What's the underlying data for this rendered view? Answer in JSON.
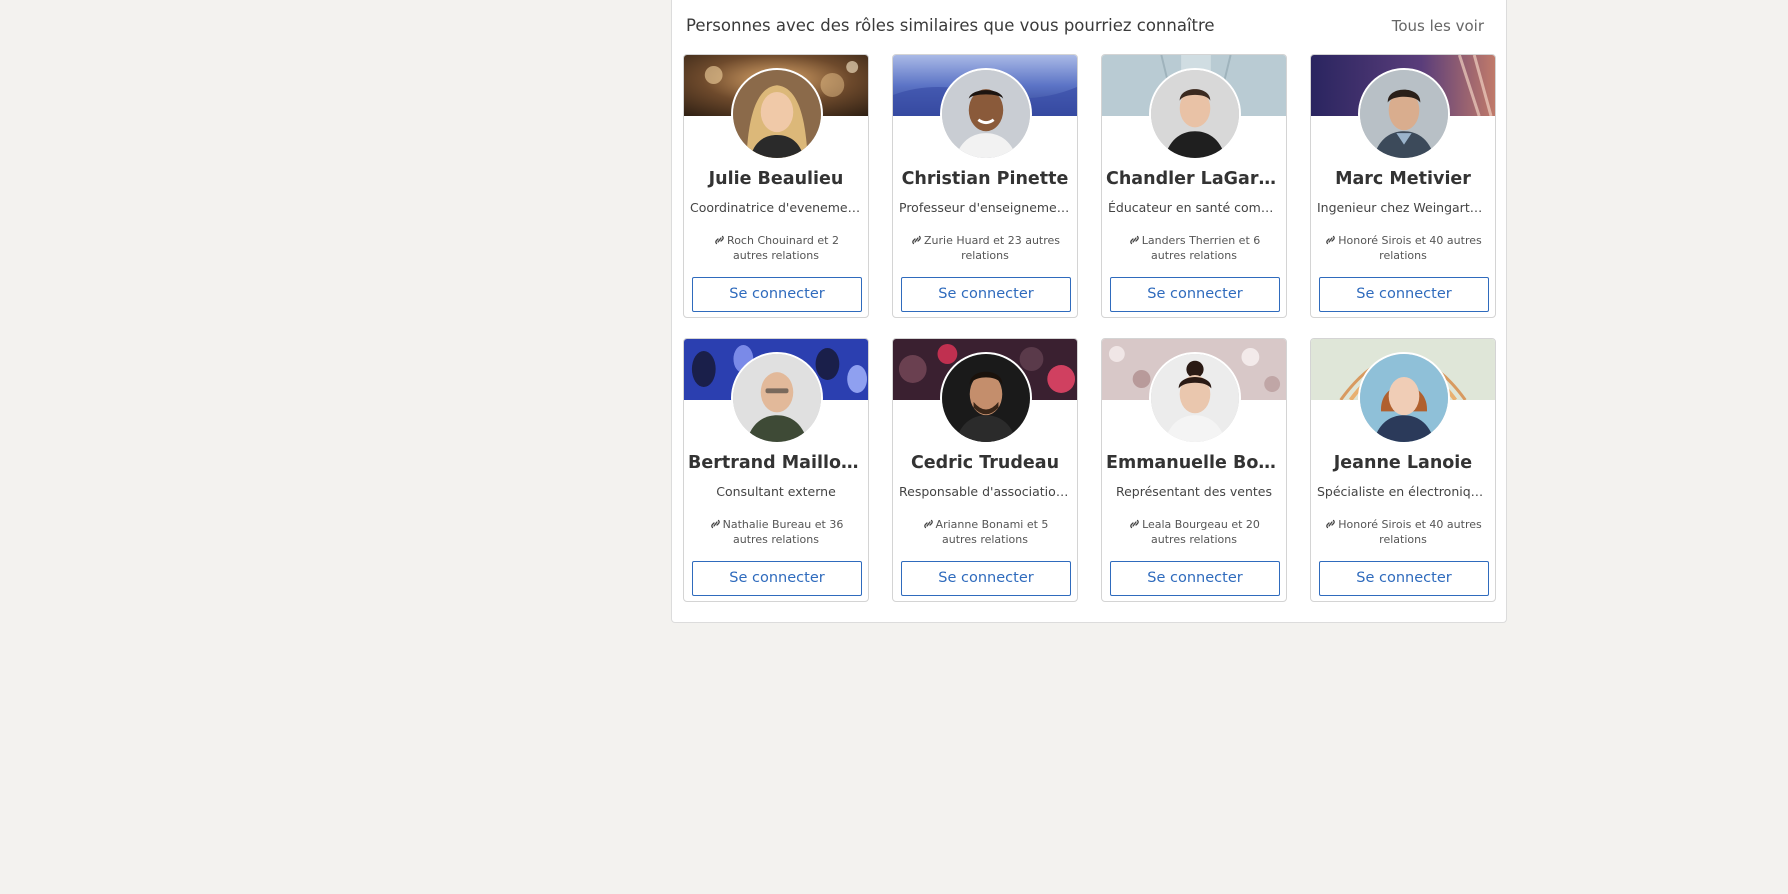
{
  "header": {
    "title": "Personnes avec des rôles similaires que vous pourriez connaître",
    "see_all": "Tous les voir"
  },
  "people": [
    {
      "name": "Julie Beaulieu",
      "role": "Coordinatrice d'evenement...",
      "mutual": "Roch Chouinard et 2 autres relations",
      "button": "Se connecter"
    },
    {
      "name": "Christian Pinette",
      "role": "Professeur d'enseignement...",
      "mutual": "Zurie Huard et 23 autres relations",
      "button": "Se connecter"
    },
    {
      "name": "Chandler LaGarde",
      "role": "Éducateur en santé commu...",
      "mutual": "Landers Therrien et 6 autres relations",
      "button": "Se connecter"
    },
    {
      "name": "Marc Metivier",
      "role": "Ingenieur chez Weingarten's",
      "mutual": "Honoré Sirois et 40 autres relations",
      "button": "Se connecter"
    },
    {
      "name": "Bertrand Mailloux",
      "role": "Consultant externe",
      "mutual": "Nathalie Bureau et 36 autres relations",
      "button": "Se connecter"
    },
    {
      "name": "Cedric Trudeau",
      "role": "Responsable d'association ...",
      "mutual": "Arianne Bonami et 5 autres relations",
      "button": "Se connecter"
    },
    {
      "name": "Emmanuelle Bons...",
      "role": "Représentant des ventes",
      "mutual": "Leala Bourgeau et 20 autres relations",
      "button": "Se connecter"
    },
    {
      "name": "Jeanne Lanoie",
      "role": "Spécialiste en électronique ...",
      "mutual": "Honoré Sirois et 40 autres relations",
      "button": "Se connecter"
    }
  ],
  "colors": {
    "accent": "#2f6bbd",
    "page_background": "#f3f2ef"
  }
}
